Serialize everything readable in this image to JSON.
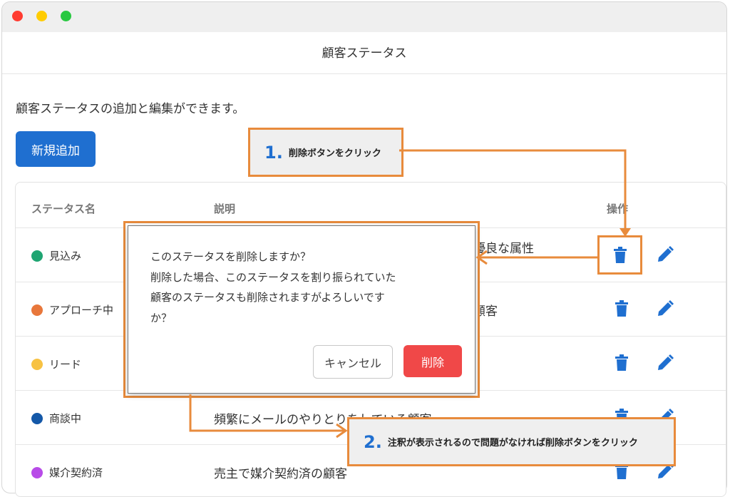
{
  "window": {
    "controls": [
      "close",
      "minimize",
      "zoom"
    ],
    "title": "顧客ステータス"
  },
  "page": {
    "description": "顧客ステータスの追加と編集ができます。",
    "new_button": "新規追加"
  },
  "table": {
    "headers": {
      "status_name": "ステータス名",
      "description": "説明",
      "actions": "操作"
    },
    "rows": [
      {
        "name": "見込み",
        "color": "#1fa572",
        "description": "優良な属性"
      },
      {
        "name": "アプローチ中",
        "color": "#e8773b",
        "description": "顧客"
      },
      {
        "name": "リード",
        "color": "#f7c243",
        "description": ""
      },
      {
        "name": "商談中",
        "color": "#1458a8",
        "description": "頻繁にメールのやりとりをしている顧客"
      },
      {
        "name": "媒介契約済",
        "color": "#b84be8",
        "description": "売主で媒介契約済の顧客"
      }
    ],
    "action_icons": [
      "trash-icon",
      "pencil-icon"
    ]
  },
  "dialog": {
    "lines": [
      "このステータスを削除しますか？",
      "削除した場合、このステータスを割り振られていた",
      "顧客のステータスも削除されますがよろしいです",
      "か？"
    ],
    "cancel_label": "キャンセル",
    "delete_label": "削除"
  },
  "callouts": [
    {
      "number": "1.",
      "text": "削除ボタンをクリック"
    },
    {
      "number": "2.",
      "text": "注釈が表示されるので問題がなければ削除ボタンをクリック"
    }
  ],
  "colors": {
    "accent": "#1f6fd0",
    "danger": "#f04848",
    "callout_border": "#e88b3c"
  }
}
